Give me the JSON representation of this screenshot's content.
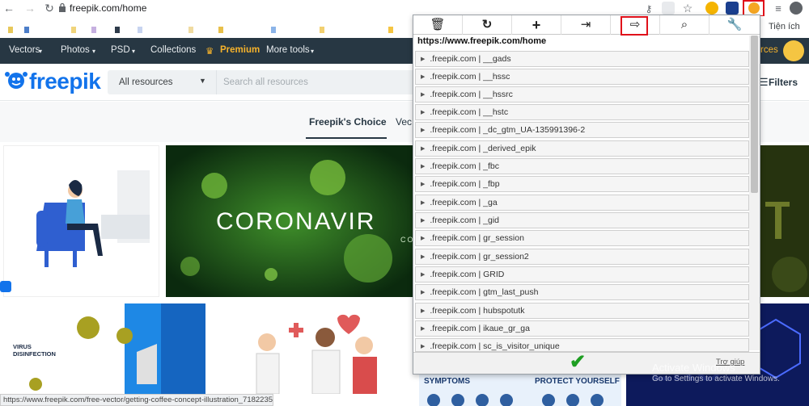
{
  "browser": {
    "url": "freepik.com/home",
    "extensions_label": "Tiện ích"
  },
  "site": {
    "nav": [
      "Vectors",
      "Photos",
      "PSD",
      "Collections",
      "Premium",
      "More tools"
    ],
    "nav_right_partial": "rces",
    "logo": "freepik",
    "resource_select": "All resources",
    "search_placeholder": "Search all resources",
    "filters": "Filters",
    "tabs": [
      "Freepik's Choice",
      "Vec"
    ],
    "corona_text": "CORONAVIR",
    "corona_sub": "CO",
    "virus_title": "VIRUS\nDISINFECTION",
    "symptoms": "SYMPTOMS",
    "protect": "PROTECT YOURSELF"
  },
  "cookie_popup": {
    "toolbar": [
      "delete-icon",
      "refresh-icon",
      "add-icon",
      "import-icon",
      "export-icon",
      "search-icon",
      "options-icon"
    ],
    "site_url": "https://www.freepik.com/home",
    "cookies": [
      ".freepik.com | __gads",
      ".freepik.com | __hssc",
      ".freepik.com | __hssrc",
      ".freepik.com | __hstc",
      ".freepik.com | _dc_gtm_UA-135991396-2",
      ".freepik.com | _derived_epik",
      ".freepik.com | _fbc",
      ".freepik.com | _fbp",
      ".freepik.com | _ga",
      ".freepik.com | _gid",
      ".freepik.com | gr_session",
      ".freepik.com | gr_session2",
      ".freepik.com | GRID",
      ".freepik.com | gtm_last_push",
      ".freepik.com | hubspotutk",
      ".freepik.com | ikaue_gr_ga",
      ".freepik.com | sc_is_visitor_unique"
    ],
    "help_link": "Trợ giúp"
  },
  "status_url": "https://www.freepik.com/free-vector/getting-coffee-concept-illustration_7182235....",
  "watermark": {
    "line1": "Activate Windows",
    "line2": "Go to Settings to activate Windows."
  },
  "colors": {
    "freepik_blue": "#1273eb",
    "nav_bg": "#273743",
    "highlight": "#e0101a",
    "check": "#1e9e22"
  }
}
